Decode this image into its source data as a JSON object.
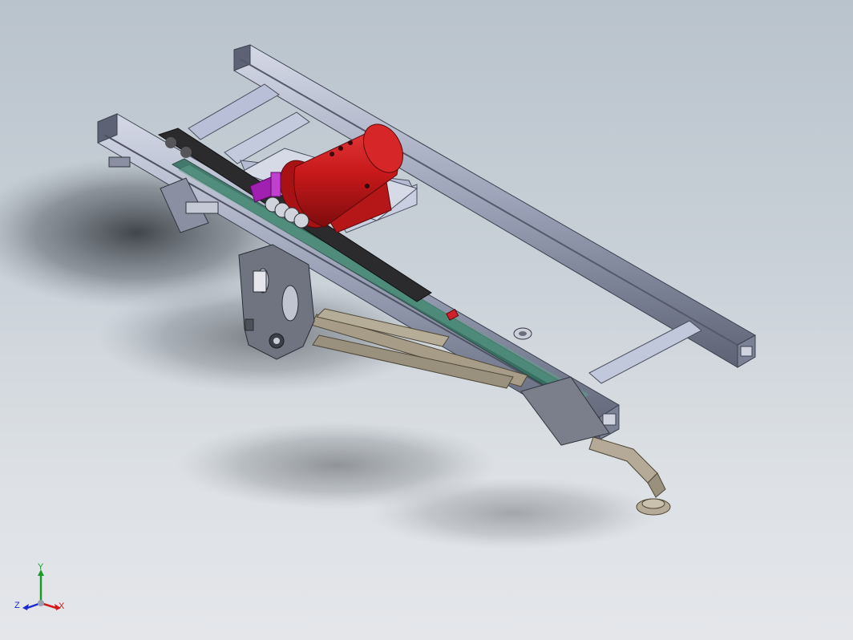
{
  "viewport": {
    "background_top": "#b9c3cc",
    "background_bottom": "#e4e6ea"
  },
  "model": {
    "rail_color": "#9aa1b6",
    "cross_member_color": "#b8bfd6",
    "tank_color": "#c8191b",
    "guide_strip_color": "#2e6b5a",
    "bracket_color": "#a020b0",
    "arm_color": "#9a907e",
    "plate_color": "#6f7480"
  },
  "triad": {
    "x_label": "X",
    "y_label": "Y",
    "z_label": "Z",
    "x_color": "#d21a1a",
    "y_color": "#1c9a2a",
    "z_color": "#1c2ad2"
  }
}
